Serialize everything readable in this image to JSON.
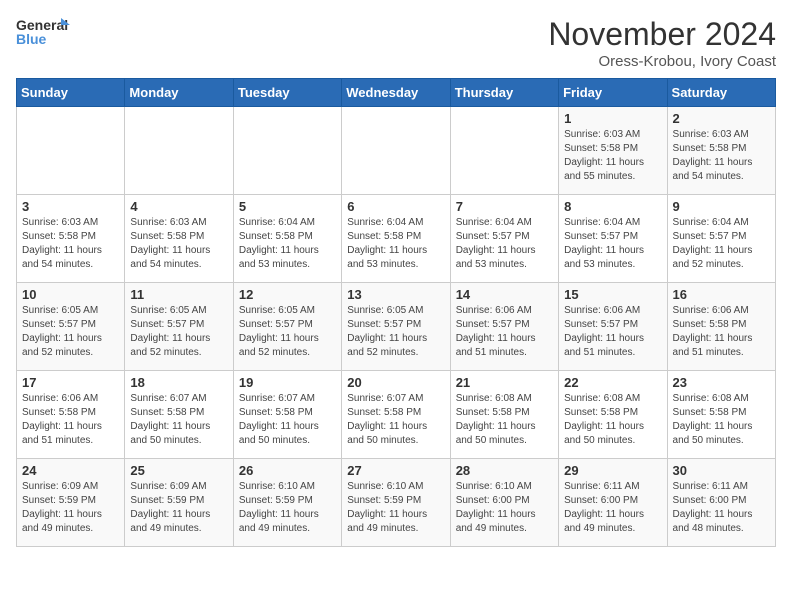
{
  "header": {
    "logo_line1": "General",
    "logo_line2": "Blue",
    "month": "November 2024",
    "location": "Oress-Krobou, Ivory Coast"
  },
  "weekdays": [
    "Sunday",
    "Monday",
    "Tuesday",
    "Wednesday",
    "Thursday",
    "Friday",
    "Saturday"
  ],
  "weeks": [
    [
      {
        "day": "",
        "info": ""
      },
      {
        "day": "",
        "info": ""
      },
      {
        "day": "",
        "info": ""
      },
      {
        "day": "",
        "info": ""
      },
      {
        "day": "",
        "info": ""
      },
      {
        "day": "1",
        "info": "Sunrise: 6:03 AM\nSunset: 5:58 PM\nDaylight: 11 hours and 55 minutes."
      },
      {
        "day": "2",
        "info": "Sunrise: 6:03 AM\nSunset: 5:58 PM\nDaylight: 11 hours and 54 minutes."
      }
    ],
    [
      {
        "day": "3",
        "info": "Sunrise: 6:03 AM\nSunset: 5:58 PM\nDaylight: 11 hours and 54 minutes."
      },
      {
        "day": "4",
        "info": "Sunrise: 6:03 AM\nSunset: 5:58 PM\nDaylight: 11 hours and 54 minutes."
      },
      {
        "day": "5",
        "info": "Sunrise: 6:04 AM\nSunset: 5:58 PM\nDaylight: 11 hours and 53 minutes."
      },
      {
        "day": "6",
        "info": "Sunrise: 6:04 AM\nSunset: 5:58 PM\nDaylight: 11 hours and 53 minutes."
      },
      {
        "day": "7",
        "info": "Sunrise: 6:04 AM\nSunset: 5:57 PM\nDaylight: 11 hours and 53 minutes."
      },
      {
        "day": "8",
        "info": "Sunrise: 6:04 AM\nSunset: 5:57 PM\nDaylight: 11 hours and 53 minutes."
      },
      {
        "day": "9",
        "info": "Sunrise: 6:04 AM\nSunset: 5:57 PM\nDaylight: 11 hours and 52 minutes."
      }
    ],
    [
      {
        "day": "10",
        "info": "Sunrise: 6:05 AM\nSunset: 5:57 PM\nDaylight: 11 hours and 52 minutes."
      },
      {
        "day": "11",
        "info": "Sunrise: 6:05 AM\nSunset: 5:57 PM\nDaylight: 11 hours and 52 minutes."
      },
      {
        "day": "12",
        "info": "Sunrise: 6:05 AM\nSunset: 5:57 PM\nDaylight: 11 hours and 52 minutes."
      },
      {
        "day": "13",
        "info": "Sunrise: 6:05 AM\nSunset: 5:57 PM\nDaylight: 11 hours and 52 minutes."
      },
      {
        "day": "14",
        "info": "Sunrise: 6:06 AM\nSunset: 5:57 PM\nDaylight: 11 hours and 51 minutes."
      },
      {
        "day": "15",
        "info": "Sunrise: 6:06 AM\nSunset: 5:57 PM\nDaylight: 11 hours and 51 minutes."
      },
      {
        "day": "16",
        "info": "Sunrise: 6:06 AM\nSunset: 5:58 PM\nDaylight: 11 hours and 51 minutes."
      }
    ],
    [
      {
        "day": "17",
        "info": "Sunrise: 6:06 AM\nSunset: 5:58 PM\nDaylight: 11 hours and 51 minutes."
      },
      {
        "day": "18",
        "info": "Sunrise: 6:07 AM\nSunset: 5:58 PM\nDaylight: 11 hours and 50 minutes."
      },
      {
        "day": "19",
        "info": "Sunrise: 6:07 AM\nSunset: 5:58 PM\nDaylight: 11 hours and 50 minutes."
      },
      {
        "day": "20",
        "info": "Sunrise: 6:07 AM\nSunset: 5:58 PM\nDaylight: 11 hours and 50 minutes."
      },
      {
        "day": "21",
        "info": "Sunrise: 6:08 AM\nSunset: 5:58 PM\nDaylight: 11 hours and 50 minutes."
      },
      {
        "day": "22",
        "info": "Sunrise: 6:08 AM\nSunset: 5:58 PM\nDaylight: 11 hours and 50 minutes."
      },
      {
        "day": "23",
        "info": "Sunrise: 6:08 AM\nSunset: 5:58 PM\nDaylight: 11 hours and 50 minutes."
      }
    ],
    [
      {
        "day": "24",
        "info": "Sunrise: 6:09 AM\nSunset: 5:59 PM\nDaylight: 11 hours and 49 minutes."
      },
      {
        "day": "25",
        "info": "Sunrise: 6:09 AM\nSunset: 5:59 PM\nDaylight: 11 hours and 49 minutes."
      },
      {
        "day": "26",
        "info": "Sunrise: 6:10 AM\nSunset: 5:59 PM\nDaylight: 11 hours and 49 minutes."
      },
      {
        "day": "27",
        "info": "Sunrise: 6:10 AM\nSunset: 5:59 PM\nDaylight: 11 hours and 49 minutes."
      },
      {
        "day": "28",
        "info": "Sunrise: 6:10 AM\nSunset: 6:00 PM\nDaylight: 11 hours and 49 minutes."
      },
      {
        "day": "29",
        "info": "Sunrise: 6:11 AM\nSunset: 6:00 PM\nDaylight: 11 hours and 49 minutes."
      },
      {
        "day": "30",
        "info": "Sunrise: 6:11 AM\nSunset: 6:00 PM\nDaylight: 11 hours and 48 minutes."
      }
    ]
  ]
}
